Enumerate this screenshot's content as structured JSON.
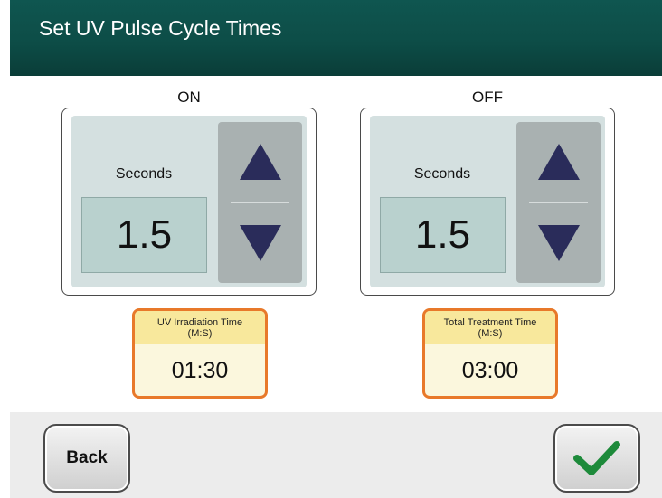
{
  "header": {
    "title": "Set UV Pulse Cycle Times"
  },
  "on_panel": {
    "label": "ON",
    "unit": "Seconds",
    "value": "1.5",
    "up_icon": "triangle-up-icon",
    "down_icon": "triangle-down-icon"
  },
  "off_panel": {
    "label": "OFF",
    "unit": "Seconds",
    "value": "1.5",
    "up_icon": "triangle-up-icon",
    "down_icon": "triangle-down-icon"
  },
  "irradiation": {
    "title": "UV Irradiation Time",
    "subtitle": "(M:S)",
    "value": "01:30"
  },
  "treatment": {
    "title": "Total Treatment Time",
    "subtitle": "(M:S)",
    "value": "03:00"
  },
  "footer": {
    "back_label": "Back",
    "confirm_icon": "checkmark-icon"
  },
  "colors": {
    "header": "#0d4d47",
    "accent_orange": "#e8792a",
    "arrow": "#2a2c5a",
    "check": "#1d8a3a"
  }
}
